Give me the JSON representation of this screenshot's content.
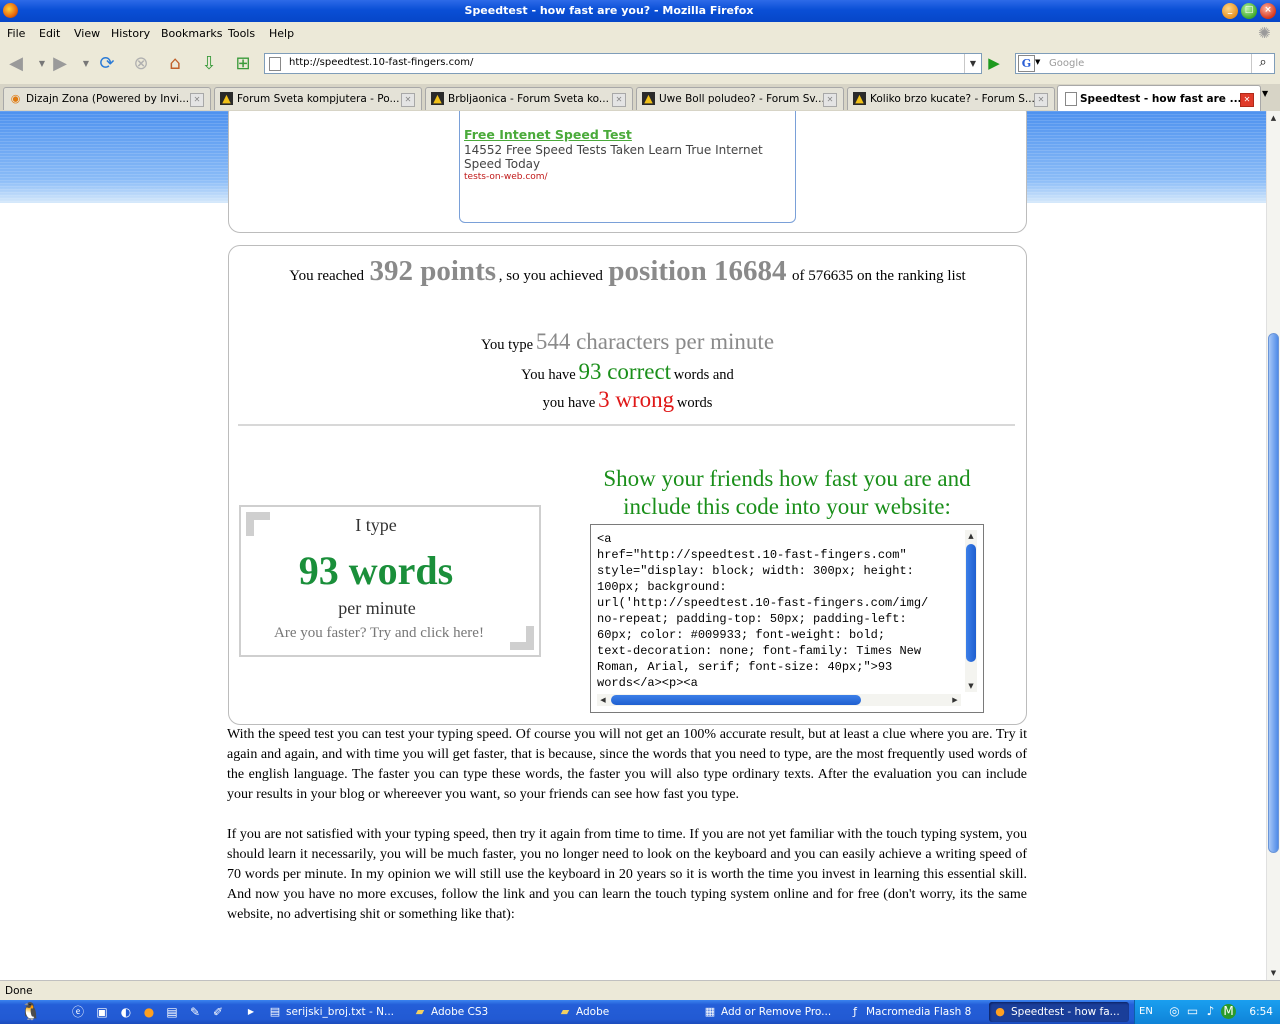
{
  "window": {
    "title": "Speedtest - how fast are you? - Mozilla Firefox",
    "controls": {
      "minimize": "_",
      "maximize": "□",
      "close": "×"
    }
  },
  "menu": [
    "File",
    "Edit",
    "View",
    "History",
    "Bookmarks",
    "Tools",
    "Help"
  ],
  "nav": {
    "back_icon": "arrow-left-icon",
    "forward_icon": "arrow-right-icon",
    "url": "http://speedtest.10-fast-fingers.com/",
    "search_placeholder": "Google",
    "search_engine_letter": "G"
  },
  "tabs": [
    {
      "label": "Dizajn Zona (Powered by Invi...",
      "icon": "orange-circle-icon"
    },
    {
      "label": "Forum Sveta kompjutera - Po...",
      "icon": "forum-icon"
    },
    {
      "label": "Brbljaonica - Forum Sveta ko...",
      "icon": "forum-icon"
    },
    {
      "label": "Uwe Boll poludeo? - Forum Sv...",
      "icon": "forum-icon"
    },
    {
      "label": "Koliko brzo kucate? - Forum S...",
      "icon": "forum-icon"
    },
    {
      "label": "Speedtest - how fast are ...",
      "icon": "page-icon",
      "active": true
    }
  ],
  "ad": {
    "title": "Free Intenet Speed Test",
    "text": "14552 Free Speed Tests Taken Learn True Internet Speed Today",
    "url": "tests-on-web.com/"
  },
  "result": {
    "reached_prefix": "You reached",
    "points": "392 points",
    "achieved_mid": ", so you achieved",
    "position": "position 16684",
    "ranking_suffix": "of 576635 on the ranking list",
    "type_prefix": "You type",
    "cpm": "544 characters per minute",
    "have_prefix": "You have",
    "correct": "93 correct",
    "correct_suffix": "words and",
    "have_prefix2": "you have",
    "wrong": "3 wrong",
    "wrong_suffix": "words"
  },
  "badge": {
    "line1": "I type",
    "words": "93 words",
    "line3": "per minute",
    "line4": "Are you faster? Try and click here!"
  },
  "share": {
    "heading": "Show your friends how fast you are and include this code into your website:",
    "code": "<a\nhref=\"http://speedtest.10-fast-fingers.com\"\nstyle=\"display: block; width: 300px; height:\n100px; background:\nurl('http://speedtest.10-fast-fingers.com/img/\nno-repeat; padding-top: 50px; padding-left:\n60px; color: #009933; font-weight: bold;\ntext-decoration: none; font-family: Times New\nRoman, Arial, serif; font-size: 40px;\">93\nwords</a><p><a"
  },
  "paragraphs": [
    "With the speed test you can test your typing speed. Of course you will not get an 100% accurate result, but at least a clue where you are. Try it again and again, and with time you will get faster, that is because, since the words that you need to type, are the most frequently used words of the english language. The faster you can type these words, the faster you will also type ordinary texts. After the evaluation you can include your results in your blog or whereever you want, so your friends can see how fast you type.",
    "If you are not satisfied with your typing speed, then try it again from time to time. If you are not yet familiar with the touch typing system, you should learn it necessarily, you will be much faster, you no longer need to look on the keyboard and you can easily achieve a writing speed of 70 words per minute. In my opinion we will still use the keyboard in 20 years so it is worth the time you invest in learning this essential skill. And now you have no more excuses, follow the link and you can learn the touch typing system online and for free (don't worry, its the same website, no advertising shit or something like that):"
  ],
  "status": "Done",
  "taskbar": {
    "items": [
      {
        "label": "serijski_broj.txt - N...",
        "icon": "notepad-icon"
      },
      {
        "label": "Adobe CS3",
        "icon": "folder-icon"
      },
      {
        "label": "Adobe",
        "icon": "folder-icon"
      },
      {
        "label": "Add or Remove Pro...",
        "icon": "control-panel-icon"
      },
      {
        "label": "Macromedia Flash 8",
        "icon": "flash-icon"
      },
      {
        "label": "Speedtest - how fa...",
        "icon": "firefox-icon",
        "active": true
      }
    ],
    "language": "EN",
    "clock": "6:54"
  },
  "colors": {
    "accent_green": "#1a8f1a",
    "wrong_red": "#e01818",
    "xp_blue": "#245ed8"
  }
}
